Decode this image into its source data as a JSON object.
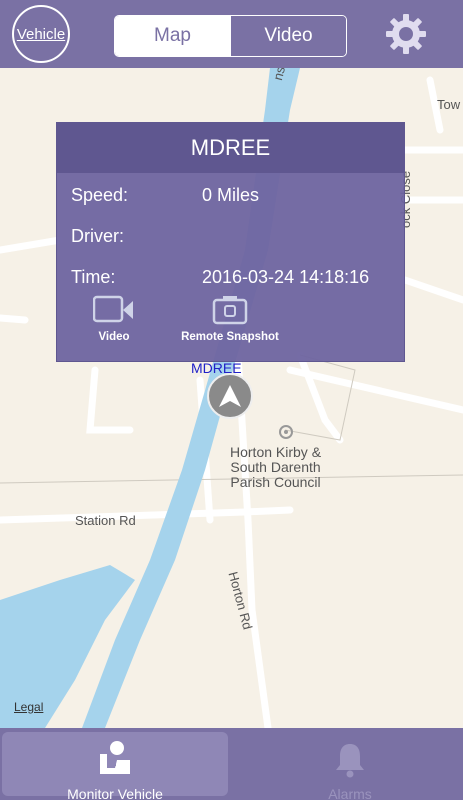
{
  "header": {
    "vehicle_label": "Vehicle",
    "segments": {
      "map": "Map",
      "video": "Video"
    },
    "settings_icon": "gear-icon"
  },
  "map": {
    "streets": {
      "station_rd": "Station Rd",
      "horton_rd": "Horton Rd",
      "ronsdale": "nsdale R",
      "close": "ock Close",
      "tow": "Tow"
    },
    "poi": {
      "line1": "Horton Kirby &",
      "line2": "South Darenth",
      "line3": "Parish Council"
    },
    "legal": "Legal",
    "marker_label": "MDREE",
    "colors": {
      "water": "#a5d3ec",
      "land": "#f6f1e7"
    }
  },
  "popup": {
    "title": "MDREE",
    "speed_label": "Speed:",
    "speed_value": "0 Miles",
    "driver_label": "Driver:",
    "driver_value": "",
    "time_label": "Time:",
    "time_value": "2016-03-24 14:18:16",
    "actions": {
      "video": "Video",
      "snapshot": "Remote Snapshot"
    }
  },
  "tabbar": {
    "monitor": "Monitor Vehicle",
    "alarms": "Alarms"
  },
  "theme": {
    "primary": "#7a71a4",
    "accent": "#ffffff"
  }
}
